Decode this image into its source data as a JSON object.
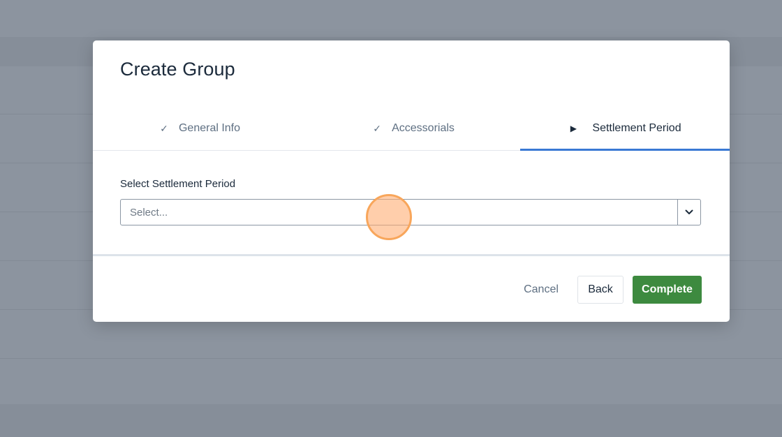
{
  "modal": {
    "title": "Create Group"
  },
  "steps": [
    {
      "label": "General Info",
      "status": "completed",
      "icon": "check-icon"
    },
    {
      "label": "Accessorials",
      "status": "completed",
      "icon": "check-icon"
    },
    {
      "label": "Settlement Period",
      "status": "active",
      "icon": "play-icon"
    }
  ],
  "form": {
    "settlement_period": {
      "label": "Select Settlement Period",
      "placeholder": "Select...",
      "value": ""
    }
  },
  "footer": {
    "cancel_label": "Cancel",
    "back_label": "Back",
    "complete_label": "Complete"
  },
  "colors": {
    "accent": "#3a79d4",
    "primary_button": "#3d8a3f",
    "overlay": "#8c949f"
  }
}
